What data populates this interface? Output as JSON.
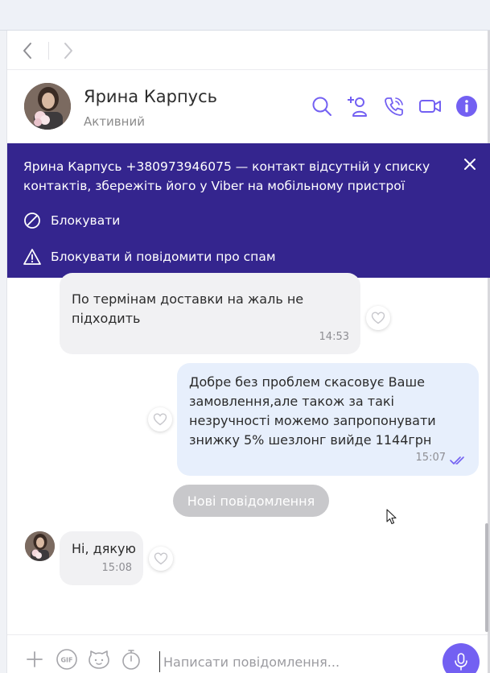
{
  "contact": {
    "name": "Ярина Карпусь",
    "status": "Активний"
  },
  "banner": {
    "text": "Ярина Карпусь +380973946075 — контакт відсутній у списку контактів, збережіть його у Viber на мобільному пристрої",
    "block_label": "Блокувати",
    "block_spam_label": "Блокувати й повідомити про спам"
  },
  "messages": [
    {
      "direction": "incoming",
      "text": "По термінам доставки на жаль не підходить",
      "time": "14:53"
    },
    {
      "direction": "outgoing",
      "text": "Добре без проблем скасовує Ваше замовлення,але також за такі незручності можемо запропонувати знижку 5% шезлонг вийде 1144грн",
      "time": "15:07",
      "status": "read"
    },
    {
      "direction": "incoming",
      "text": "Ні, дякую",
      "time": "15:08"
    }
  ],
  "new_messages_label": "Нові повідомлення",
  "composer": {
    "placeholder": "Написати повідомлення..."
  },
  "colors": {
    "accent": "#7360f2",
    "banner_bg": "#34258e",
    "incoming_bubble": "#f1f1f3",
    "outgoing_bubble": "#e7effc"
  },
  "icons": {
    "nav": [
      "chevron-left-icon",
      "chevron-right-icon"
    ],
    "header": [
      "search-icon",
      "add-contact-icon",
      "phone-icon",
      "video-icon",
      "info-icon"
    ],
    "composer": [
      "plus-icon",
      "gif-icon",
      "sticker-icon",
      "timer-icon",
      "microphone-icon"
    ]
  }
}
